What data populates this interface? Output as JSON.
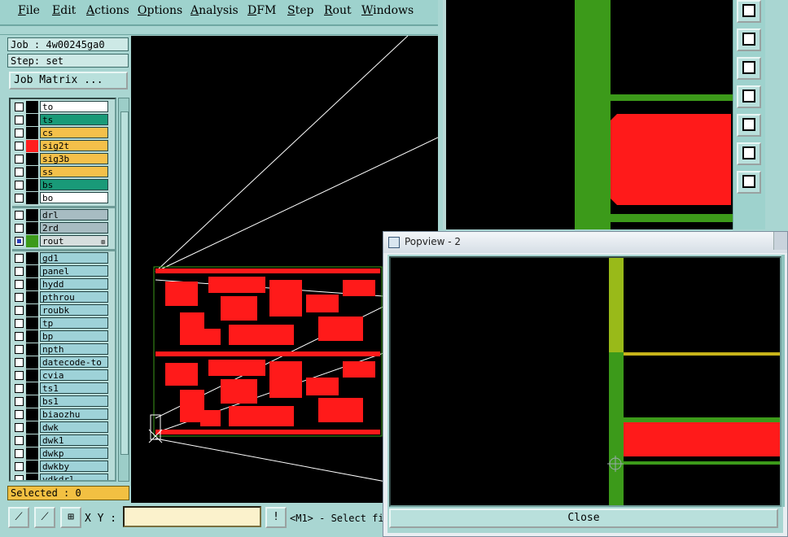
{
  "menu": [
    "File",
    "Edit",
    "Actions",
    "Options",
    "Analysis",
    "DFM",
    "Step",
    "Rout",
    "Windows"
  ],
  "job": {
    "job_label": "Job : 4w00245ga0",
    "step_label": "Step: set",
    "matrix_button": "Job Matrix ..."
  },
  "layers": [
    {
      "name": "to",
      "color": "#ffffff",
      "swatch": "#000000",
      "checked": false
    },
    {
      "name": "ts",
      "color": "#199a78",
      "swatch": "#000000",
      "checked": false
    },
    {
      "name": "cs",
      "color": "#f4c04a",
      "swatch": "#000000",
      "checked": false
    },
    {
      "name": "sig2t",
      "color": "#f4c04a",
      "swatch": "#ff1f1f",
      "checked": false
    },
    {
      "name": "sig3b",
      "color": "#f4c04a",
      "swatch": "#000000",
      "checked": false
    },
    {
      "name": "ss",
      "color": "#f4c04a",
      "swatch": "#000000",
      "checked": false
    },
    {
      "name": "bs",
      "color": "#199a78",
      "swatch": "#000000",
      "checked": false
    },
    {
      "name": "bo",
      "color": "#ffffff",
      "swatch": "#000000",
      "checked": false
    },
    {
      "name": "drl",
      "color": "#a7bcc2",
      "swatch": "#000000",
      "checked": false
    },
    {
      "name": "2rd",
      "color": "#a7bcc2",
      "swatch": "#000000",
      "checked": false
    },
    {
      "name": "rout",
      "color": "#d6dede",
      "swatch": "#3c9a1a",
      "checked": true,
      "mark": "⊞"
    },
    {
      "name": "gd1",
      "color": "#9ed2d8",
      "swatch": "#000000",
      "checked": false
    },
    {
      "name": "panel",
      "color": "#9ed2d8",
      "swatch": "#000000",
      "checked": false
    },
    {
      "name": "hydd",
      "color": "#9ed2d8",
      "swatch": "#000000",
      "checked": false
    },
    {
      "name": "pthrou",
      "color": "#9ed2d8",
      "swatch": "#000000",
      "checked": false
    },
    {
      "name": "roubk",
      "color": "#9ed2d8",
      "swatch": "#000000",
      "checked": false
    },
    {
      "name": "tp",
      "color": "#9ed2d8",
      "swatch": "#000000",
      "checked": false
    },
    {
      "name": "bp",
      "color": "#9ed2d8",
      "swatch": "#000000",
      "checked": false
    },
    {
      "name": "npth",
      "color": "#9ed2d8",
      "swatch": "#000000",
      "checked": false
    },
    {
      "name": "datecode-to",
      "color": "#9ed2d8",
      "swatch": "#000000",
      "checked": false
    },
    {
      "name": "cvia",
      "color": "#9ed2d8",
      "swatch": "#000000",
      "checked": false
    },
    {
      "name": "ts1",
      "color": "#9ed2d8",
      "swatch": "#000000",
      "checked": false
    },
    {
      "name": "bs1",
      "color": "#9ed2d8",
      "swatch": "#000000",
      "checked": false
    },
    {
      "name": "biaozhu",
      "color": "#9ed2d8",
      "swatch": "#000000",
      "checked": false
    },
    {
      "name": "dwk",
      "color": "#9ed2d8",
      "swatch": "#000000",
      "checked": false
    },
    {
      "name": "dwk1",
      "color": "#9ed2d8",
      "swatch": "#000000",
      "checked": false
    },
    {
      "name": "dwkp",
      "color": "#9ed2d8",
      "swatch": "#000000",
      "checked": false
    },
    {
      "name": "dwkby",
      "color": "#9ed2d8",
      "swatch": "#000000",
      "checked": false
    },
    {
      "name": "vdkdrl",
      "color": "#9ed2d8",
      "swatch": "#000000",
      "checked": false
    }
  ],
  "selected_label": "Selected : 0",
  "bottom": {
    "xy_label": "X Y :",
    "xy_value": "",
    "status": "<M1> - Select fi",
    "warn_glyph": "!"
  },
  "popview": {
    "title": "Popview - 2",
    "close_label": "Close"
  },
  "colors": {
    "board_red": "#ff1a1a",
    "rout_green": "#3c9a1a",
    "panel_bg": "#a9d6d2"
  }
}
